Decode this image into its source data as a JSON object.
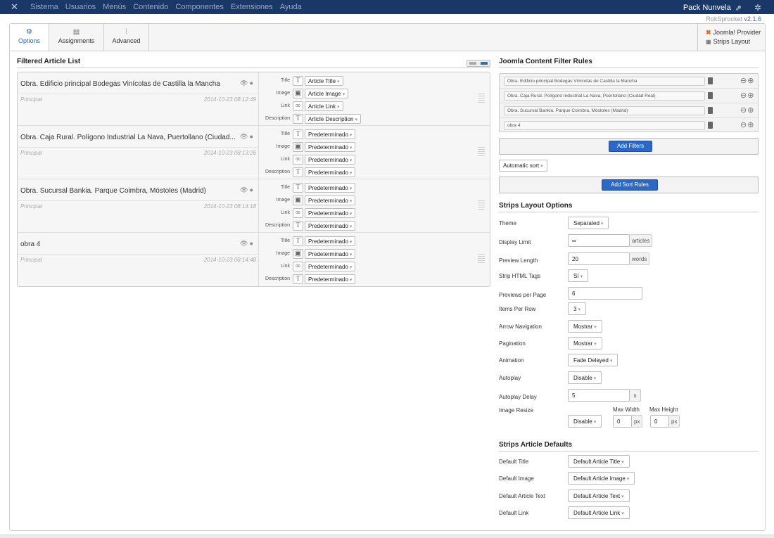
{
  "topnav": {
    "logo_icon": "joomla-x-icon",
    "menu": [
      "Sistema",
      "Usuarios",
      "Menús",
      "Contenido",
      "Componentes",
      "Extensiones",
      "Ayuda"
    ],
    "site_name": "Pack Nunvela",
    "external_icon": "⇗",
    "gear_icon": "✲"
  },
  "version": {
    "name": "RokSprocket",
    "number": "v2.1.6"
  },
  "tabs": {
    "options": {
      "label": "Options",
      "icon": "⚙"
    },
    "assignments": {
      "label": "Assignments",
      "icon": "▤"
    },
    "advanced": {
      "label": "Advanced",
      "icon": "⫶"
    }
  },
  "provider": {
    "line1": "Joomla! Provider",
    "line2": "Strips Layout"
  },
  "filtered_list": {
    "title": "Filtered Article List",
    "field_labels": {
      "title": "Title",
      "image": "Image",
      "link": "Link",
      "description": "Description"
    },
    "articles": [
      {
        "title": "Obra. Edificio principal Bodegas Vinícolas de Castilla la Mancha",
        "category": "Principal",
        "date": "2014-10-23 08:12:49",
        "title_val": "Article Title",
        "image_val": "Article Image",
        "link_val": "Article Link",
        "desc_val": "Article Description"
      },
      {
        "title": "Obra. Caja Rural. Polígono Industrial La Nava, Puertollano (Ciudad...",
        "category": "Principal",
        "date": "2014-10-23 08:13:26",
        "title_val": "Predeterminado",
        "image_val": "Predeterminado",
        "link_val": "Predeterminado",
        "desc_val": "Predeterminado"
      },
      {
        "title": "Obra. Sucursal Bankia. Parque Coimbra, Móstoles (Madrid)",
        "category": "Principal",
        "date": "2014-10-23 08:14:18",
        "title_val": "Predeterminado",
        "image_val": "Predeterminado",
        "link_val": "Predeterminado",
        "desc_val": "Predeterminado"
      },
      {
        "title": "obra 4",
        "category": "Principal",
        "date": "2014-10-23 08:14:48",
        "title_val": "Predeterminado",
        "image_val": "Predeterminado",
        "link_val": "Predeterminado",
        "desc_val": "Predeterminado"
      }
    ]
  },
  "filter_rules": {
    "title": "Joomla Content Filter Rules",
    "filters": [
      "Obra. Edificio principal Bodegas Vinícolas de Castilla la Mancha",
      "Obra. Caja Rural. Polígono Industrial La Nava, Puertollano (Ciudad Real)",
      "Obra. Sucursal Bankia. Parque Coimbra, Móstoles (Madrid)",
      "obra 4"
    ],
    "add_filters": "Add Filters",
    "sort": "Automatic sort",
    "add_sort_rules": "Add Sort Rules"
  },
  "layout_options": {
    "title": "Strips Layout Options",
    "theme": {
      "label": "Theme",
      "value": "Separated"
    },
    "display_limit": {
      "label": "Display Limit",
      "value": "∞",
      "unit": "articles"
    },
    "preview_length": {
      "label": "Preview Length",
      "value": "20",
      "unit": "words"
    },
    "strip_html": {
      "label": "Strip HTML Tags",
      "value": "Sí"
    },
    "previews_per_page": {
      "label": "Previews per Page",
      "value": "6"
    },
    "items_per_row": {
      "label": "Items Per Row",
      "value": "3"
    },
    "arrow_nav": {
      "label": "Arrow Navigation",
      "value": "Mostrar"
    },
    "pagination": {
      "label": "Pagination",
      "value": "Mostrar"
    },
    "animation": {
      "label": "Animation",
      "value": "Fade Delayed"
    },
    "autoplay": {
      "label": "Autoplay",
      "value": "Disable"
    },
    "autoplay_delay": {
      "label": "Autoplay Delay",
      "value": "5",
      "unit": "s"
    },
    "image_resize": {
      "label": "Image Resize",
      "value": "Disable",
      "max_width_label": "Max Width",
      "max_height_label": "Max Height",
      "max_width": "0",
      "max_height": "0",
      "unit": "px"
    }
  },
  "article_defaults": {
    "title": "Strips Article Defaults",
    "default_title": {
      "label": "Default Title",
      "value": "Default Article Title"
    },
    "default_image": {
      "label": "Default Image",
      "value": "Default Article Image"
    },
    "default_text": {
      "label": "Default Article Text",
      "value": "Default Article Text"
    },
    "default_link": {
      "label": "Default Link",
      "value": "Default Article Link"
    }
  },
  "colors": {
    "nav_bg": "#1a3867",
    "accent": "#2b68c7",
    "provider_icon": "#e16a2b"
  }
}
